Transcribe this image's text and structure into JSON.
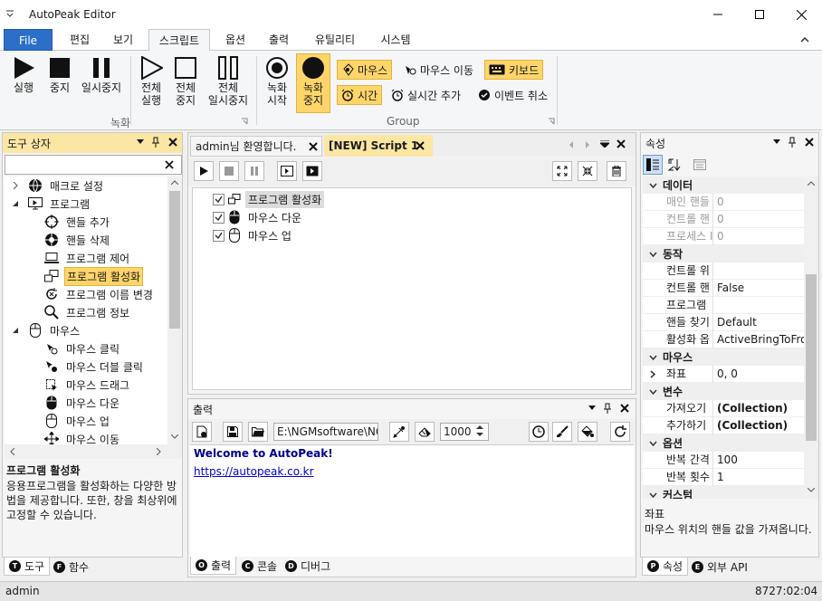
{
  "window": {
    "title": "AutoPeak Editor"
  },
  "menu": {
    "items": [
      "File",
      "편집",
      "보기",
      "스크립트",
      "옵션",
      "출력",
      "유틸리티",
      "시스템"
    ],
    "active": "스크립트"
  },
  "ribbon": {
    "run": "실행",
    "stop": "중지",
    "pause": "일시중지",
    "run_all": [
      "전체",
      "실행"
    ],
    "stop_all": [
      "전체",
      "중지"
    ],
    "pause_all": [
      "전체",
      "일시중지"
    ],
    "rec_start": [
      "녹화",
      "시작"
    ],
    "rec_stop": [
      "녹화",
      "중지"
    ],
    "group_record": "녹화",
    "group_group": "Group",
    "mouse": "마우스",
    "mouse_move": "마우스 이동",
    "keyboard": "키보드",
    "time": "시간",
    "realtime_add": "실시간 추가",
    "event_cancel": "이벤트 취소"
  },
  "toolbox": {
    "title": "도구 상자",
    "items": [
      {
        "label": "매크로 설정",
        "level": 0,
        "icon": "globe-icon"
      },
      {
        "label": "프로그램",
        "level": 0,
        "icon": "monitor-icon"
      },
      {
        "label": "핸들 추가",
        "level": 1,
        "icon": "crosshair-icon"
      },
      {
        "label": "핸들 삭제",
        "level": 1,
        "icon": "target-icon"
      },
      {
        "label": "프로그램 제어",
        "level": 1,
        "icon": "laptop-icon"
      },
      {
        "label": "프로그램 활성화",
        "level": 1,
        "icon": "windows-icon",
        "selected": true
      },
      {
        "label": "프로그램 이름 변경",
        "level": 1,
        "icon": "rename-icon"
      },
      {
        "label": "프로그램 정보",
        "level": 1,
        "icon": "magnifier-icon"
      },
      {
        "label": "마우스",
        "level": 0,
        "icon": "mouse-icon"
      },
      {
        "label": "마우스 클릭",
        "level": 1,
        "icon": "mouse-click-icon"
      },
      {
        "label": "마우스 더블 클릭",
        "level": 1,
        "icon": "mouse-dblclick-icon"
      },
      {
        "label": "마우스 드래그",
        "level": 1,
        "icon": "mouse-drag-icon"
      },
      {
        "label": "마우스 다운",
        "level": 1,
        "icon": "mouse-down-icon"
      },
      {
        "label": "마우스 업",
        "level": 1,
        "icon": "mouse-up-icon"
      },
      {
        "label": "마우스 이동",
        "level": 1,
        "icon": "mouse-move-icon"
      }
    ],
    "desc_title": "프로그램 활성화",
    "desc_text": "응용프로그램을 활성화하는 다양한 방법을 제공합니다. 또한, 창을 최상위에 고정할 수 있습니다.",
    "tabs": [
      "도구",
      "함수"
    ]
  },
  "editor": {
    "tabs": [
      "admin님 환영합니다.",
      "[NEW] Script 1"
    ],
    "lines": [
      "프로그램 활성화",
      "마우스 다운",
      "마우스 업"
    ]
  },
  "output": {
    "title": "출력",
    "path": "E:\\NGMsoftware\\NG",
    "count": "1000",
    "lines": [
      "Welcome to AutoPeak!",
      "https://autopeak.co.kr"
    ],
    "tabs": [
      "출력",
      "콘솔",
      "디버그"
    ]
  },
  "properties": {
    "title": "속성",
    "rows": [
      {
        "type": "cat",
        "label": "데이터"
      },
      {
        "type": "row",
        "k": "매인 핸들",
        "v": "0",
        "dim": true
      },
      {
        "type": "row",
        "k": "컨트롤 핸",
        "v": "0",
        "dim": true
      },
      {
        "type": "row",
        "k": "프로세스 I",
        "v": "0",
        "dim": true
      },
      {
        "type": "cat",
        "label": "동작"
      },
      {
        "type": "row",
        "k": "컨트롤 위",
        "v": ""
      },
      {
        "type": "row",
        "k": "컨트롤 핸",
        "v": "False"
      },
      {
        "type": "row",
        "k": "프로그램",
        "v": ""
      },
      {
        "type": "row",
        "k": "핸들 찾기",
        "v": "Default"
      },
      {
        "type": "row",
        "k": "활성화 옵",
        "v": "ActiveBringToFron"
      },
      {
        "type": "cat",
        "label": "마우스"
      },
      {
        "type": "row",
        "k": "좌표",
        "v": "0, 0",
        "expand": true
      },
      {
        "type": "cat",
        "label": "변수"
      },
      {
        "type": "row",
        "k": "가져오기",
        "v": "(Collection)",
        "bold": true
      },
      {
        "type": "row",
        "k": "추가하기",
        "v": "(Collection)",
        "bold": true
      },
      {
        "type": "cat",
        "label": "옵션"
      },
      {
        "type": "row",
        "k": "반복 간격",
        "v": "100"
      },
      {
        "type": "row",
        "k": "반복 횟수",
        "v": "1"
      },
      {
        "type": "cat",
        "label": "커스텀"
      }
    ],
    "desc_title": "좌표",
    "desc_text": "마우스 위치의 핸들 값을 가져옵니다.",
    "tabs": [
      "속성",
      "외부 API"
    ]
  },
  "status": {
    "user": "admin",
    "time": "8727:02:04"
  },
  "colors": {
    "accent": "#2b6fc9",
    "highlight": "#ffd56a",
    "link": "#0000cc",
    "welcome": "#00008b"
  }
}
